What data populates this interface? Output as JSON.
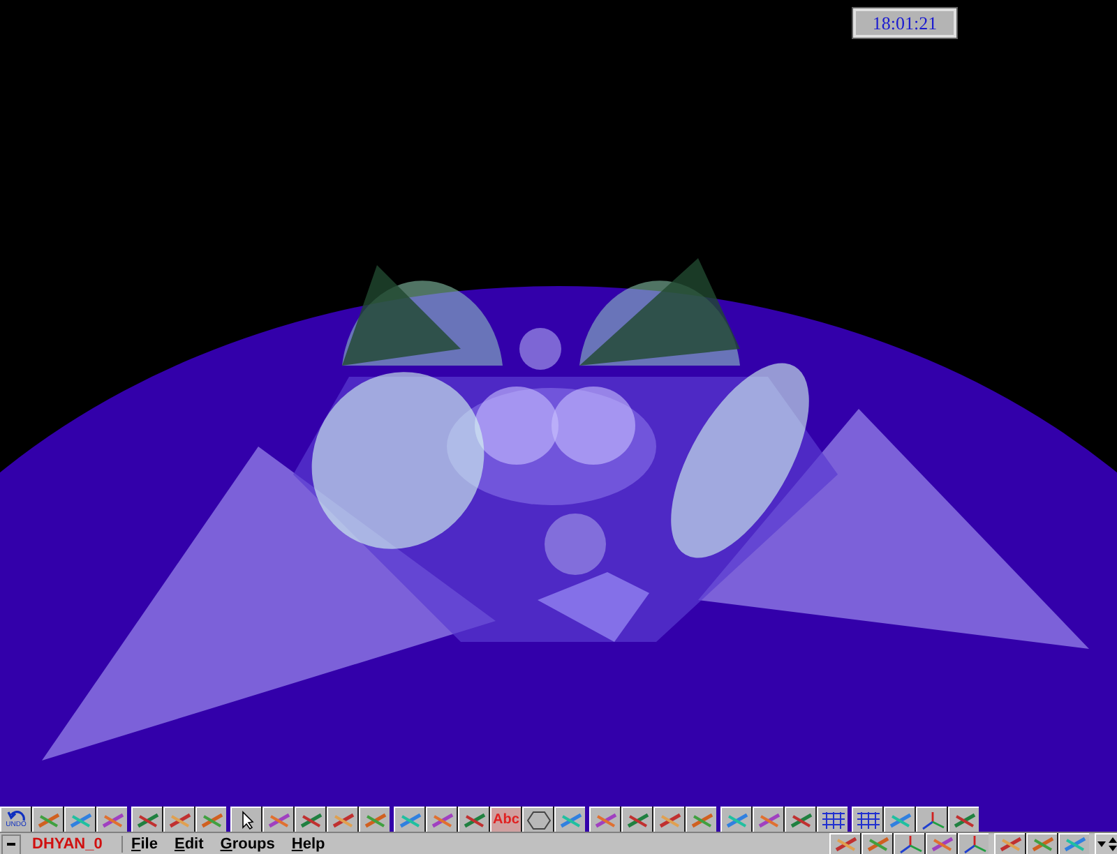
{
  "clock": "18:01:21",
  "toolbar": {
    "groups": [
      [
        {
          "kind": "undo",
          "label": "UNDO"
        },
        {
          "kind": "icon"
        },
        {
          "kind": "icon"
        },
        {
          "kind": "icon"
        }
      ],
      [
        {
          "kind": "icon"
        },
        {
          "kind": "icon"
        },
        {
          "kind": "icon"
        }
      ],
      [
        {
          "kind": "pointer"
        },
        {
          "kind": "icon"
        },
        {
          "kind": "icon"
        },
        {
          "kind": "icon"
        },
        {
          "kind": "icon"
        }
      ],
      [
        {
          "kind": "icon"
        },
        {
          "kind": "icon"
        },
        {
          "kind": "icon"
        },
        {
          "kind": "text",
          "label": "Abc"
        },
        {
          "kind": "hexagon"
        },
        {
          "kind": "icon"
        }
      ],
      [
        {
          "kind": "icon"
        },
        {
          "kind": "icon"
        },
        {
          "kind": "icon"
        },
        {
          "kind": "icon"
        }
      ],
      [
        {
          "kind": "icon"
        },
        {
          "kind": "icon"
        },
        {
          "kind": "icon"
        },
        {
          "kind": "grid"
        }
      ],
      [
        {
          "kind": "grid"
        },
        {
          "kind": "icon"
        },
        {
          "kind": "axes"
        },
        {
          "kind": "icon"
        }
      ]
    ]
  },
  "menubar": {
    "document": "DHYAN_0",
    "menus": [
      "File",
      "Edit",
      "Groups",
      "Help"
    ],
    "tools": [
      [
        {
          "kind": "icon"
        },
        {
          "kind": "icon"
        },
        {
          "kind": "axes"
        },
        {
          "kind": "icon"
        },
        {
          "kind": "axes"
        }
      ],
      [
        {
          "kind": "icon"
        },
        {
          "kind": "icon"
        },
        {
          "kind": "icon"
        }
      ],
      [
        {
          "kind": "spinner"
        }
      ]
    ]
  }
}
